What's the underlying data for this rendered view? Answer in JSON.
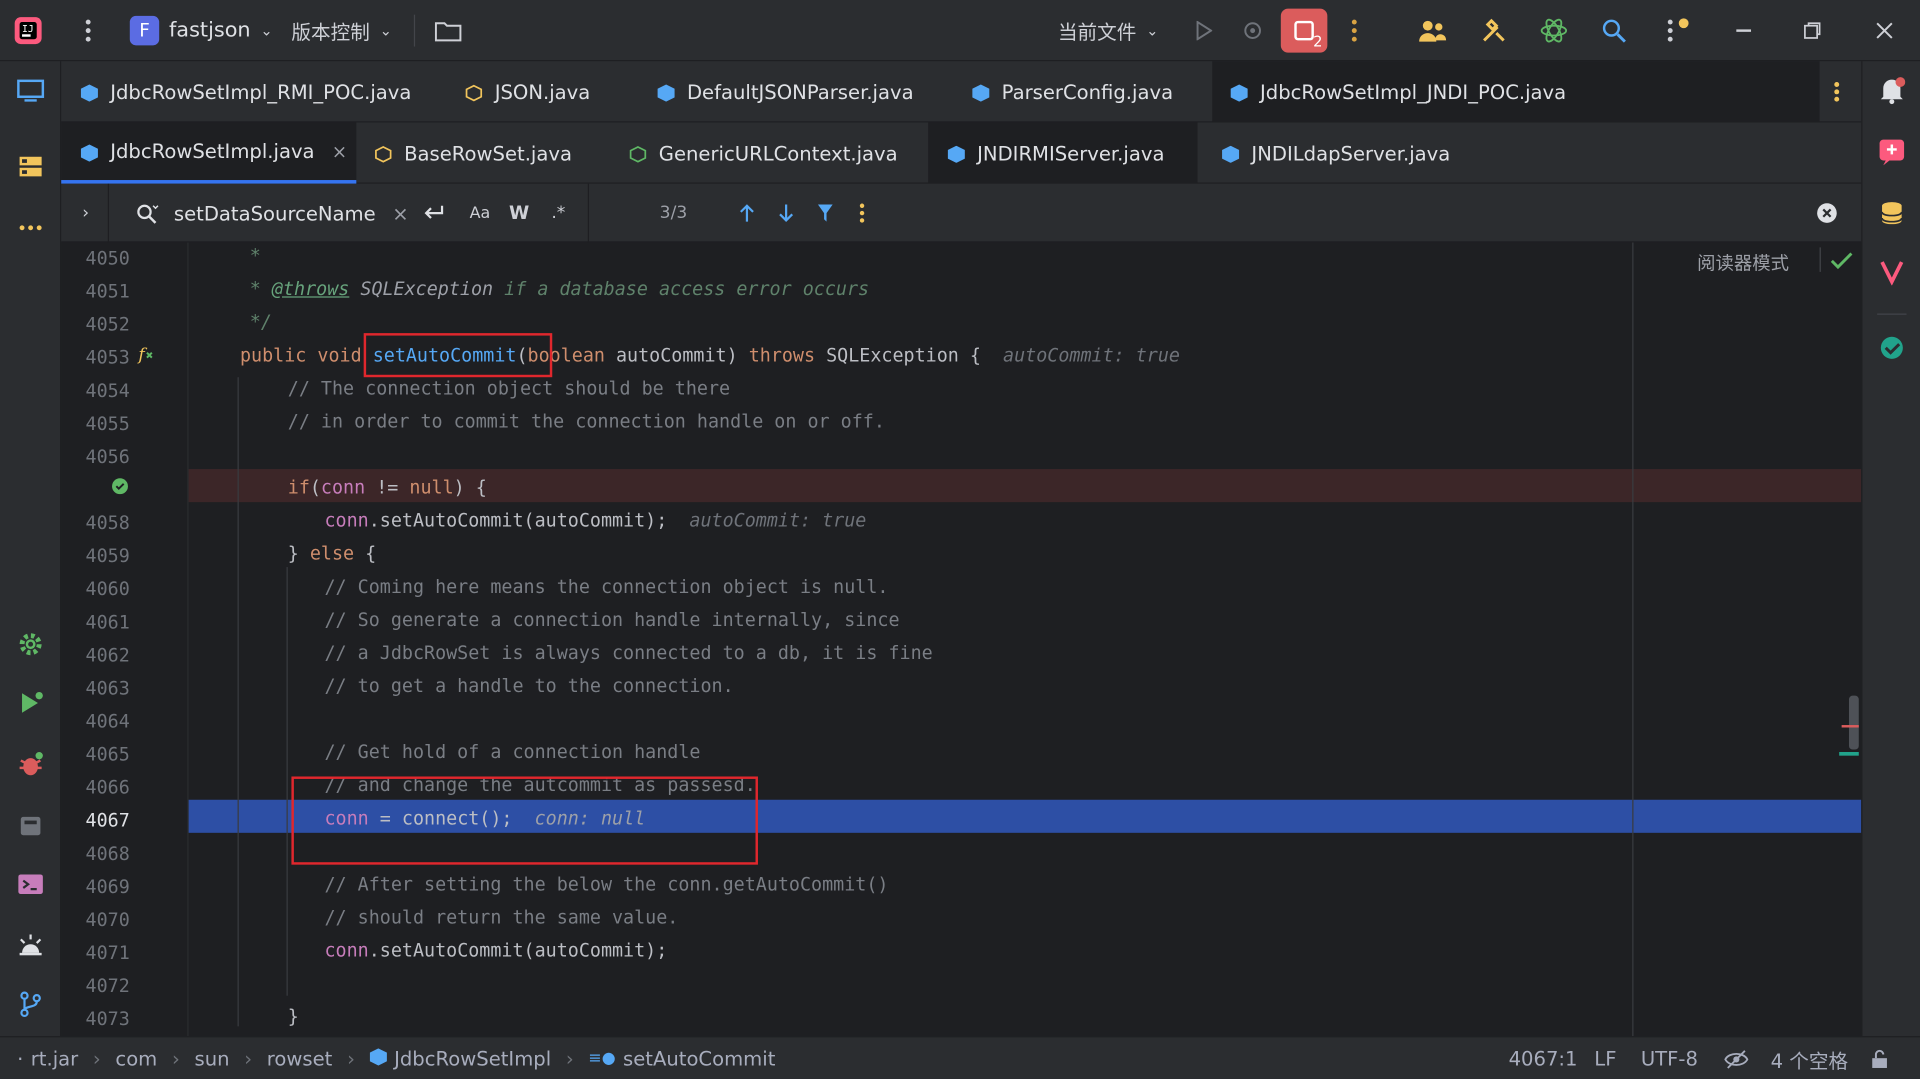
{
  "titlebar": {
    "project_badge": "F",
    "project_name": "fastjson",
    "vcs_label": "版本控制",
    "run_config": "当前文件",
    "stop_badge": "2"
  },
  "tabs_row1": [
    {
      "label": "JdbcRowSetImpl_RMI_POC.java"
    },
    {
      "label": "JSON.java"
    },
    {
      "label": "DefaultJSONParser.java"
    },
    {
      "label": "ParserConfig.java"
    },
    {
      "label": "JdbcRowSetImpl_JNDI_POC.java"
    }
  ],
  "tabs_row2": [
    {
      "label": "JdbcRowSetImpl.java",
      "active": true
    },
    {
      "label": "BaseRowSet.java"
    },
    {
      "label": "GenericURLContext.java"
    },
    {
      "label": "JNDIRMIServer.java"
    },
    {
      "label": "JNDILdapServer.java"
    }
  ],
  "find": {
    "query": "setDataSourceName",
    "match_case": "Aa",
    "words": "W",
    "regex": ".*",
    "count": "3/3"
  },
  "editor": {
    "reader_mode": "阅读器模式",
    "lines": [
      {
        "n": "4050"
      },
      {
        "n": "4051"
      },
      {
        "n": "4052"
      },
      {
        "n": "4053"
      },
      {
        "n": "4054"
      },
      {
        "n": "4055"
      },
      {
        "n": "4056"
      },
      {
        "n": ""
      },
      {
        "n": "4058"
      },
      {
        "n": "4059"
      },
      {
        "n": "4060"
      },
      {
        "n": "4061"
      },
      {
        "n": "4062"
      },
      {
        "n": "4063"
      },
      {
        "n": "4064"
      },
      {
        "n": "4065"
      },
      {
        "n": "4066"
      },
      {
        "n": "4067"
      },
      {
        "n": "4068"
      },
      {
        "n": "4069"
      },
      {
        "n": "4070"
      },
      {
        "n": "4071"
      },
      {
        "n": "4072"
      },
      {
        "n": "4073"
      }
    ],
    "code": {
      "l4050": "*",
      "l4051_a": "* ",
      "l4051_b": "@throws",
      "l4051_c": " SQLException ",
      "l4051_d": "if a database access error occurs",
      "l4052": "*/",
      "l4053_a": "public ",
      "l4053_b": "void ",
      "l4053_c": "setAutoCommit",
      "l4053_d": "(",
      "l4053_e": "boolean ",
      "l4053_f": "autoCommit) ",
      "l4053_g": "throws ",
      "l4053_h": "SQLException {",
      "l4053_hint": "autoCommit: true",
      "l4054": "// The connection object should be there",
      "l4055": "// in order to commit the connection handle on or off.",
      "l4057_a": "if",
      "l4057_b": "(",
      "l4057_c": "conn",
      "l4057_d": " != ",
      "l4057_e": "null",
      "l4057_f": ") {",
      "l4058_a": "conn",
      "l4058_b": ".setAutoCommit(autoCommit);",
      "l4058_hint": "autoCommit: true",
      "l4059_a": "} ",
      "l4059_b": "else",
      "l4059_c": " {",
      "l4060": "// Coming here means the connection object is null.",
      "l4061": "// So generate a connection handle internally, since",
      "l4062": "// a JdbcRowSet is always connected to a db, it is fine",
      "l4063": "// to get a handle to the connection.",
      "l4065": "// Get hold of a connection handle",
      "l4066": "// and change the autcommit as passesd.",
      "l4067_a": "conn",
      "l4067_b": " = ",
      "l4067_c": "connect",
      "l4067_d": "();",
      "l4067_hint": "conn: null",
      "l4069": "// After setting the below the conn.getAutoCommit()",
      "l4070": "// should return the same value.",
      "l4071_a": "conn",
      "l4071_b": ".setAutoCommit(autoCommit);",
      "l4073": "}"
    }
  },
  "status": {
    "crumbs": [
      "rt.jar",
      "com",
      "sun",
      "rowset",
      "JdbcRowSetImpl",
      "setAutoCommit"
    ],
    "position": "4067:1",
    "line_sep": "LF",
    "encoding": "UTF-8",
    "indent": "4 个空格"
  },
  "colors": {
    "accent": "#3574f0",
    "breakpoint_line": "#3c2628",
    "current_line": "#2d4fa5",
    "annotation_box": "#e0272d",
    "success": "#5fb865"
  }
}
